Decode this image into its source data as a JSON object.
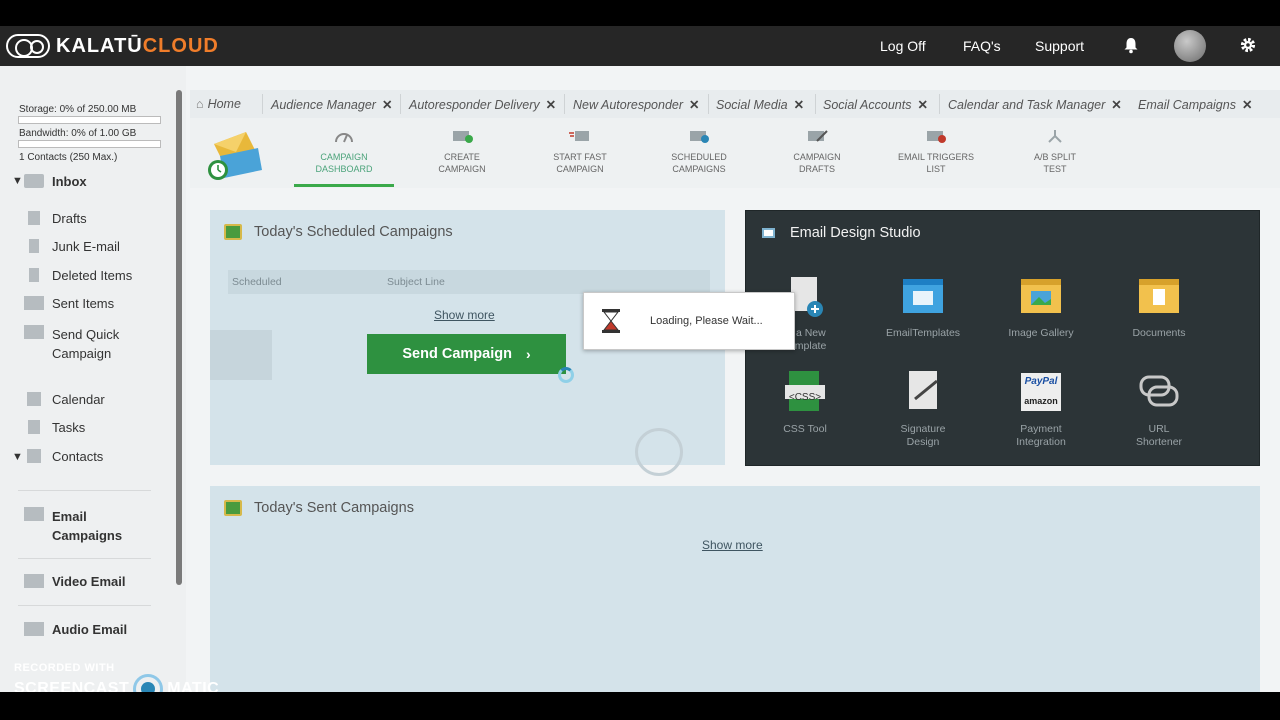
{
  "app": {
    "logo_part1": "KALATŪ",
    "logo_part2": "CLOUD",
    "log_off": "Log Off",
    "faqs": "FAQ's",
    "support": "Support"
  },
  "sidebar": {
    "storage": "Storage: 0% of 250.00 MB",
    "bandwidth": "Bandwidth: 0% of 1.00 GB",
    "contacts_quota": "1 Contacts (250 Max.)",
    "inbox": "Inbox",
    "drafts": "Drafts",
    "junk": "Junk E-mail",
    "deleted": "Deleted Items",
    "sent": "Sent Items",
    "send_quick_1": "Send Quick",
    "send_quick_2": "Campaign",
    "calendar": "Calendar",
    "tasks": "Tasks",
    "contacts": "Contacts",
    "email_campaigns_1": "Email",
    "email_campaigns_2": "Campaigns",
    "video_email": "Video Email",
    "audio_email": "Audio Email"
  },
  "tabs": [
    {
      "label": "Home"
    },
    {
      "label": "Audience Manager"
    },
    {
      "label": "Autoresponder Delivery"
    },
    {
      "label": "New Autoresponder"
    },
    {
      "label": "Social Media"
    },
    {
      "label": "Social Accounts"
    },
    {
      "label": "Calendar and Task Manager"
    },
    {
      "label": "Email Campaigns"
    }
  ],
  "tab_close": "✕",
  "toolbar": {
    "items": [
      {
        "l1": "CAMPAIGN",
        "l2": "DASHBOARD"
      },
      {
        "l1": "CREATE",
        "l2": "CAMPAIGN"
      },
      {
        "l1": "START FAST",
        "l2": "CAMPAIGN"
      },
      {
        "l1": "SCHEDULED",
        "l2": "CAMPAIGNS"
      },
      {
        "l1": "CAMPAIGN",
        "l2": "DRAFTS"
      },
      {
        "l1": "EMAIL TRIGGERS",
        "l2": "LIST"
      },
      {
        "l1": "A/B SPLIT",
        "l2": "TEST"
      }
    ]
  },
  "scheduled": {
    "title": "Today's Scheduled Campaigns",
    "col_scheduled": "Scheduled",
    "col_subject": "Subject Line",
    "show_more": "Show more",
    "send_button": "Send Campaign",
    "send_chevron": "›"
  },
  "studio": {
    "title": "Email Design Studio",
    "items": [
      {
        "l1": "te a New",
        "l2": "Template"
      },
      {
        "l1": "EmailTemplates",
        "l2": ""
      },
      {
        "l1": "Image Gallery",
        "l2": ""
      },
      {
        "l1": "Documents",
        "l2": ""
      },
      {
        "l1": "CSS Tool",
        "l2": ""
      },
      {
        "l1": "Signature",
        "l2": "Design"
      },
      {
        "l1": "Payment",
        "l2": "Integration"
      },
      {
        "l1": "URL",
        "l2": "Shortener"
      }
    ],
    "css_badge": "<CSS>",
    "paypal": "PayPal",
    "amazon": "amazon"
  },
  "sent": {
    "title": "Today's Sent Campaigns",
    "show_more": "Show more"
  },
  "loading": {
    "text": "Loading, Please Wait..."
  },
  "watermark": {
    "top": "RECORDED WITH",
    "left": "SCREENCAST",
    "right": "MATIC"
  },
  "colors": {
    "accent_green": "#2e9140",
    "brand_orange": "#f07d2a",
    "tab_active_border": "#3ab5a8"
  }
}
